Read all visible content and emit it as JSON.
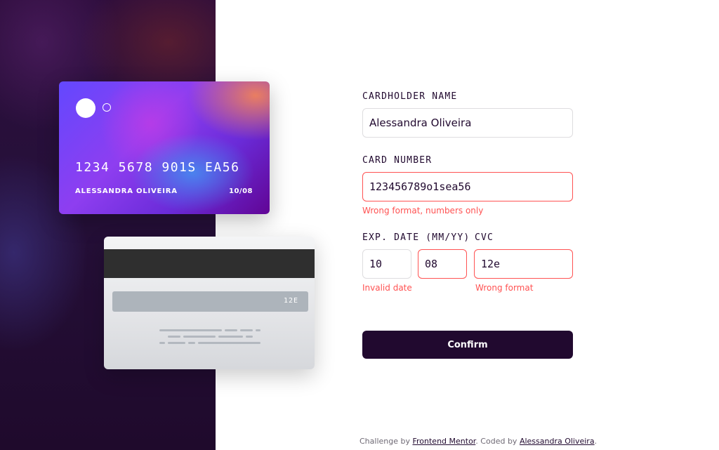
{
  "card_front": {
    "number": "1234 5678 901S EA56",
    "name": "ALESSANDRA OLIVEIRA",
    "expiry": "10/08"
  },
  "card_back": {
    "cvc": "12E"
  },
  "form": {
    "cardholder_label": "CARDHOLDER NAME",
    "cardholder_value": "Alessandra Oliveira",
    "number_label": "CARD NUMBER",
    "number_value": "123456789o1sea56",
    "number_error": "Wrong format, numbers only",
    "exp_label": "EXP. DATE (MM/YY)",
    "exp_month_value": "10",
    "exp_year_value": "08",
    "exp_error": "Invalid date",
    "cvc_label": "CVC",
    "cvc_value": "12e",
    "cvc_error": "Wrong format",
    "confirm_label": "Confirm"
  },
  "footer": {
    "prefix": "Challenge by ",
    "link1": "Frontend Mentor",
    "middle": ". Coded by ",
    "link2": "Alessandra Oliveira",
    "suffix": "."
  },
  "colors": {
    "dark_violet": "#21092f",
    "error_red": "#ff5252",
    "input_border": "#dedddf"
  }
}
